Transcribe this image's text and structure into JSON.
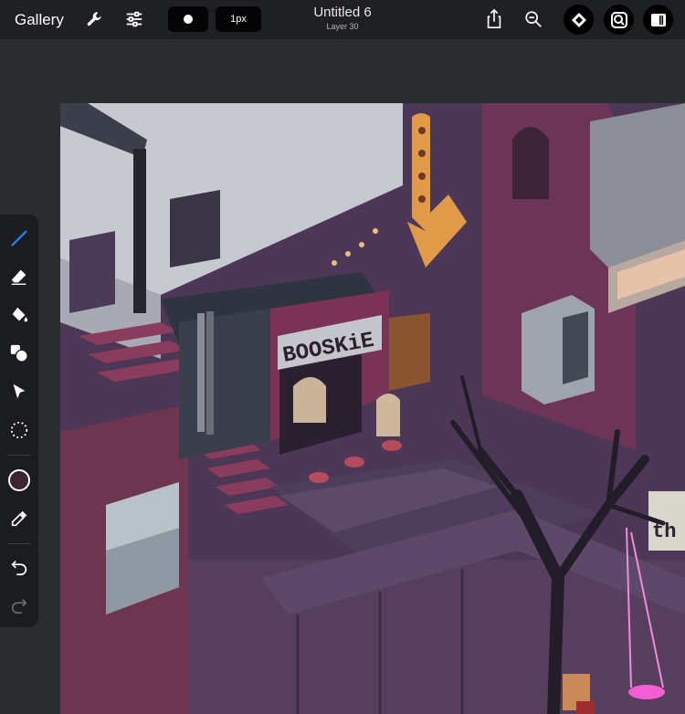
{
  "topbar": {
    "gallery_label": "Gallery",
    "brush_size_label": "1px",
    "document_title": "Untitled 6",
    "layer_name": "Layer 30"
  },
  "tools": {
    "selected": "brush",
    "current_color": "#3d2433"
  },
  "colors": {
    "accent": "#2f7bf5",
    "topbar_bg": "#1f2023",
    "workspace_bg": "#2b2c30"
  },
  "canvas": {
    "sign_text": "BOOSKiE",
    "partial_sign_text": "th"
  }
}
